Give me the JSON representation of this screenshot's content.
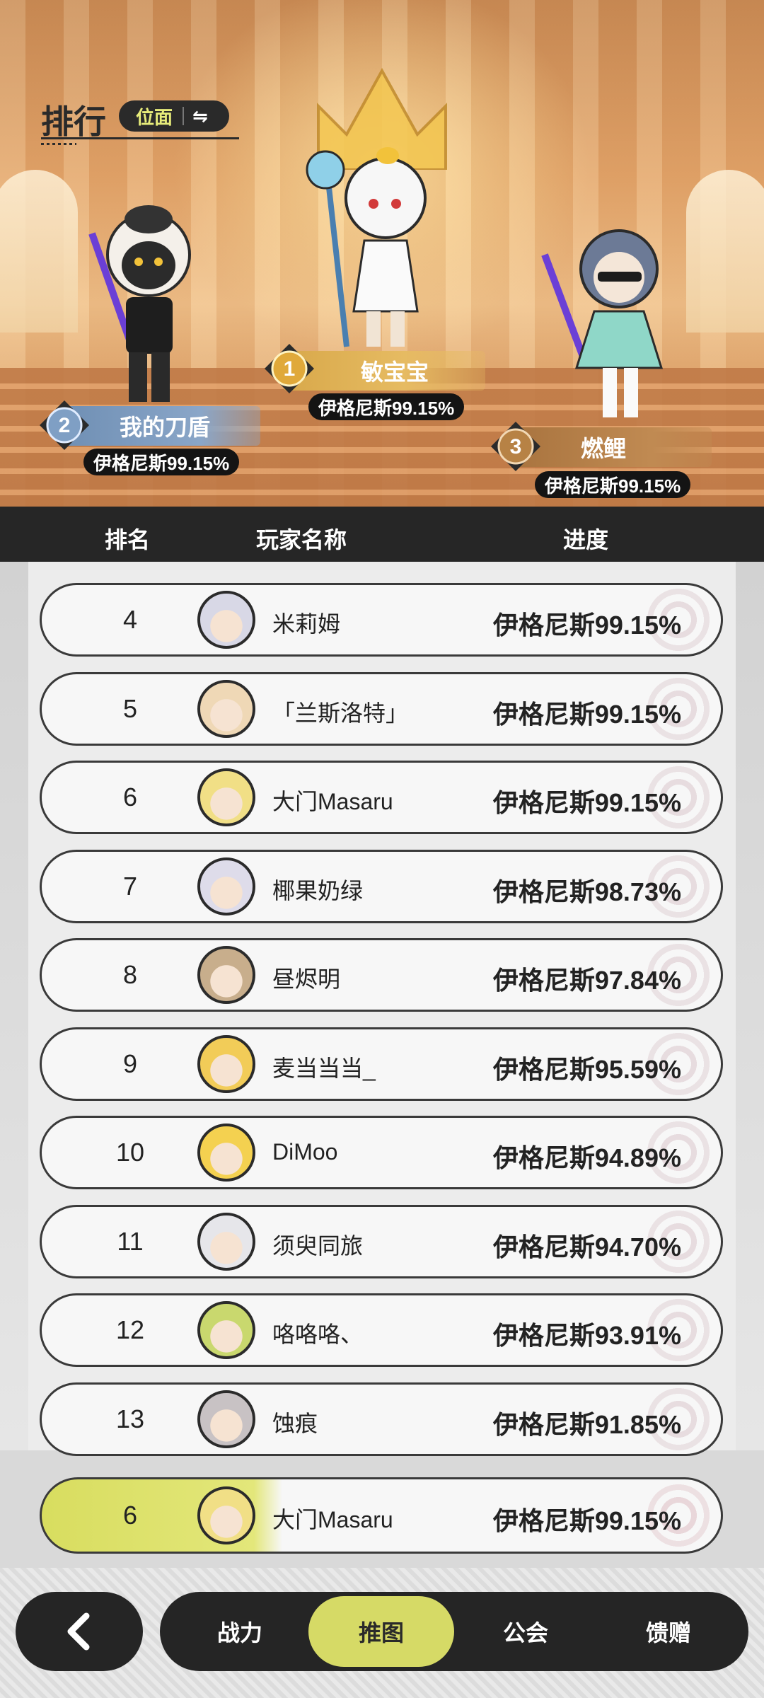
{
  "header": {
    "title": "排行",
    "plane_switch_label": "位面",
    "switch_icon": "⇋"
  },
  "podium": [
    {
      "place": "1",
      "name": "敏宝宝",
      "score": "伊格尼斯99.15%",
      "badge_color": "#e0a93a"
    },
    {
      "place": "2",
      "name": "我的刀盾",
      "score": "伊格尼斯99.15%",
      "badge_color": "#7f9fc4"
    },
    {
      "place": "3",
      "name": "燃鲤",
      "score": "伊格尼斯99.15%",
      "badge_color": "#b78245"
    }
  ],
  "table": {
    "col_rank": "排名",
    "col_player": "玩家名称",
    "col_progress": "进度"
  },
  "rows": [
    {
      "rank": "4",
      "name": "米莉姆",
      "progress": "伊格尼斯99.15%",
      "avatar_color": "#d8d8e6"
    },
    {
      "rank": "5",
      "name": "「兰斯洛特」",
      "progress": "伊格尼斯99.15%",
      "avatar_color": "#efd8b6"
    },
    {
      "rank": "6",
      "name": "大门Masaru",
      "progress": "伊格尼斯99.15%",
      "avatar_color": "#f1df86"
    },
    {
      "rank": "7",
      "name": "椰果奶绿",
      "progress": "伊格尼斯98.73%",
      "avatar_color": "#dedcea"
    },
    {
      "rank": "8",
      "name": "昼烬明",
      "progress": "伊格尼斯97.84%",
      "avatar_color": "#c8ae8c"
    },
    {
      "rank": "9",
      "name": "麦当当当_",
      "progress": "伊格尼斯95.59%",
      "avatar_color": "#f2cc58"
    },
    {
      "rank": "10",
      "name": "DiMoo",
      "progress": "伊格尼斯94.89%",
      "avatar_color": "#f4d150"
    },
    {
      "rank": "11",
      "name": "须臾同旅",
      "progress": "伊格尼斯94.70%",
      "avatar_color": "#e6e6ea"
    },
    {
      "rank": "12",
      "name": "咯咯咯、",
      "progress": "伊格尼斯93.91%",
      "avatar_color": "#c9d86e"
    },
    {
      "rank": "13",
      "name": "蚀痕",
      "progress": "伊格尼斯91.85%",
      "avatar_color": "#c8c2c4"
    }
  ],
  "self_row": {
    "rank": "6",
    "name": "大门Masaru",
    "progress": "伊格尼斯99.15%",
    "avatar_color": "#f1df86"
  },
  "nav": {
    "back_icon": "chevron-left-icon",
    "tabs": [
      {
        "label": "战力",
        "active": false
      },
      {
        "label": "推图",
        "active": true
      },
      {
        "label": "公会",
        "active": false
      },
      {
        "label": "馈赠",
        "active": false
      }
    ]
  },
  "colors": {
    "accent": "#d6da66",
    "dark": "#252525",
    "switch_text": "#e7ec7a"
  }
}
